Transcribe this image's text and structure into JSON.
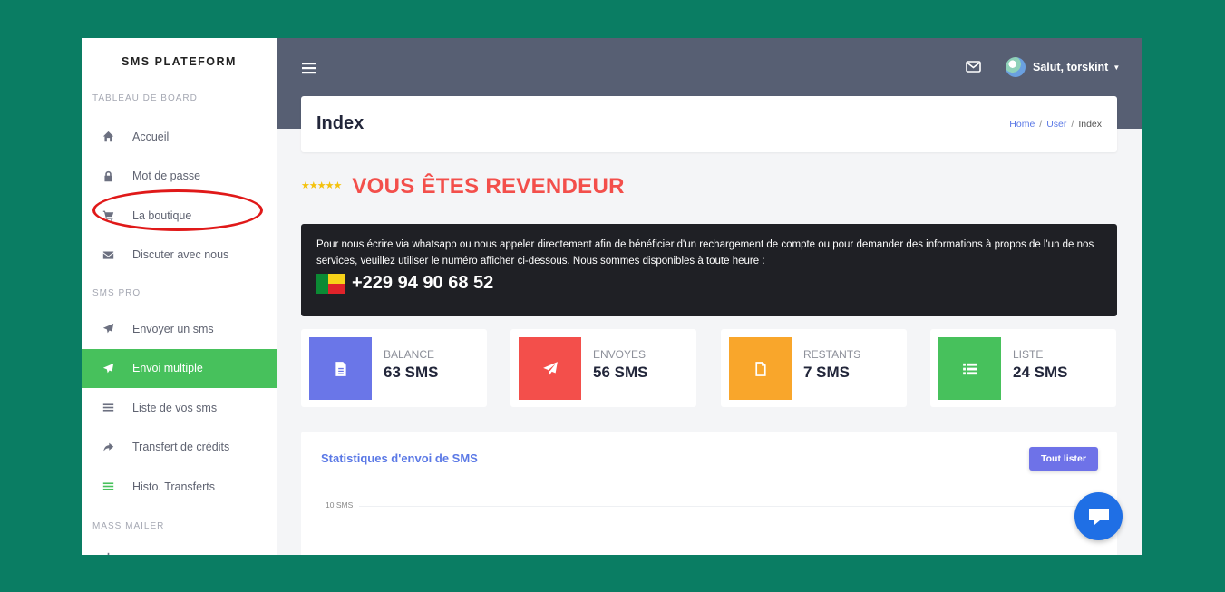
{
  "brand": "SMS PLATEFORM",
  "sidebar": {
    "sections": [
      {
        "title": "TABLEAU DE BOARD",
        "items": [
          {
            "label": "Accueil",
            "icon": "home-icon"
          },
          {
            "label": "Mot de passe",
            "icon": "lock-icon"
          },
          {
            "label": "La boutique",
            "icon": "cart-icon"
          },
          {
            "label": "Discuter avec nous",
            "icon": "envelope-icon"
          }
        ]
      },
      {
        "title": "SMS PRO",
        "items": [
          {
            "label": "Envoyer un sms",
            "icon": "paper-plane-icon"
          },
          {
            "label": "Envoi multiple",
            "icon": "paper-plane-icon",
            "active": true
          },
          {
            "label": "Liste de vos sms",
            "icon": "list-icon"
          },
          {
            "label": "Transfert de crédits",
            "icon": "share-arrow-icon"
          },
          {
            "label": "Histo. Transferts",
            "icon": "list-icon"
          }
        ]
      },
      {
        "title": "MASS MAILER",
        "items": []
      }
    ]
  },
  "header": {
    "user_label": "Salut, torskint",
    "menu_icon": "hamburger-icon",
    "mail_icon": "mail-icon"
  },
  "page": {
    "title": "Index",
    "breadcrumb": [
      "Home",
      "User",
      "Index"
    ],
    "breadcrumb_sep": "/"
  },
  "reseller": {
    "stars": "★★★★★",
    "title": "VOUS ÊTES REVENDEUR"
  },
  "notice": {
    "text": "Pour nous écrire via whatsapp ou nous appeler directement afin de bénéficier d'un rechargement de compte ou pour demander des informations à propos de l'un de nos services, veuillez utiliser le numéro afficher ci-dessous. Nous sommes disponibles à toute heure :",
    "phone": "+229 94 90 68 52"
  },
  "stats": [
    {
      "label": "BALANCE",
      "value": "63 SMS",
      "color": "#6a76e8",
      "icon": "document-icon"
    },
    {
      "label": "ENVOYES",
      "value": "56 SMS",
      "color": "#f34f4b",
      "icon": "paper-plane-icon"
    },
    {
      "label": "RESTANTS",
      "value": "7 SMS",
      "color": "#f9a62b",
      "icon": "file-icon"
    },
    {
      "label": "LISTE",
      "value": "24 SMS",
      "color": "#47c15c",
      "icon": "list-icon"
    }
  ],
  "chart": {
    "title": "Statistiques d'envoi de SMS",
    "button": "Tout lister",
    "y_tick": "10 SMS"
  },
  "colors": {
    "background": "#0a7d63",
    "topbar": "#575f73",
    "active": "#47c15c",
    "accent": "#5b79e6",
    "annotation": "#e01919"
  }
}
